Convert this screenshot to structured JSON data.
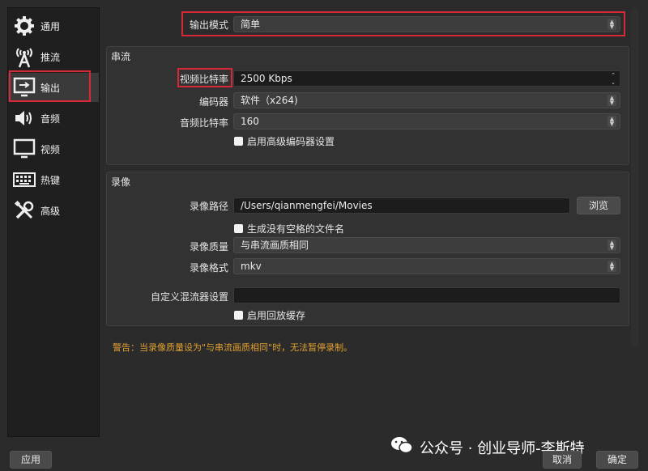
{
  "sidebar": {
    "items": [
      {
        "label": "通用",
        "icon": "gear-icon"
      },
      {
        "label": "推流",
        "icon": "broadcast-antenna-icon"
      },
      {
        "label": "输出",
        "icon": "output-monitor-icon"
      },
      {
        "label": "音频",
        "icon": "speaker-icon"
      },
      {
        "label": "视频",
        "icon": "monitor-icon"
      },
      {
        "label": "热键",
        "icon": "keyboard-icon"
      },
      {
        "label": "高级",
        "icon": "tools-icon"
      }
    ],
    "active_index": 2
  },
  "output_mode": {
    "label": "输出模式",
    "value": "简单"
  },
  "streaming": {
    "title": "串流",
    "video_bitrate": {
      "label": "视频比特率",
      "value": "2500 Kbps"
    },
    "encoder": {
      "label": "编码器",
      "value": "软件（x264)"
    },
    "audio_bitrate": {
      "label": "音频比特率",
      "value": "160"
    },
    "advanced_encoder_check": {
      "label": "启用高级编码器设置",
      "checked": false
    }
  },
  "recording": {
    "title": "录像",
    "path": {
      "label": "录像路径",
      "value": "/Users/qianmengfei/Movies",
      "browse": "浏览"
    },
    "no_space_check": {
      "label": "生成没有空格的文件名",
      "checked": false
    },
    "quality": {
      "label": "录像质量",
      "value": "与串流画质相同"
    },
    "format": {
      "label": "录像格式",
      "value": "mkv"
    },
    "muxer": {
      "label": "自定义混流器设置",
      "value": ""
    },
    "replay_buffer_check": {
      "label": "启用回放缓存",
      "checked": false
    }
  },
  "warning": "警告：当录像质量设为\"与串流画质相同\"时，无法暂停录制。",
  "buttons": {
    "apply": "应用",
    "cancel": "取消",
    "ok": "确定"
  },
  "watermark": "公众号 · 创业导师-李斯特",
  "colors": {
    "highlight_border": "#d8293a",
    "warning_text": "#e0a030"
  }
}
